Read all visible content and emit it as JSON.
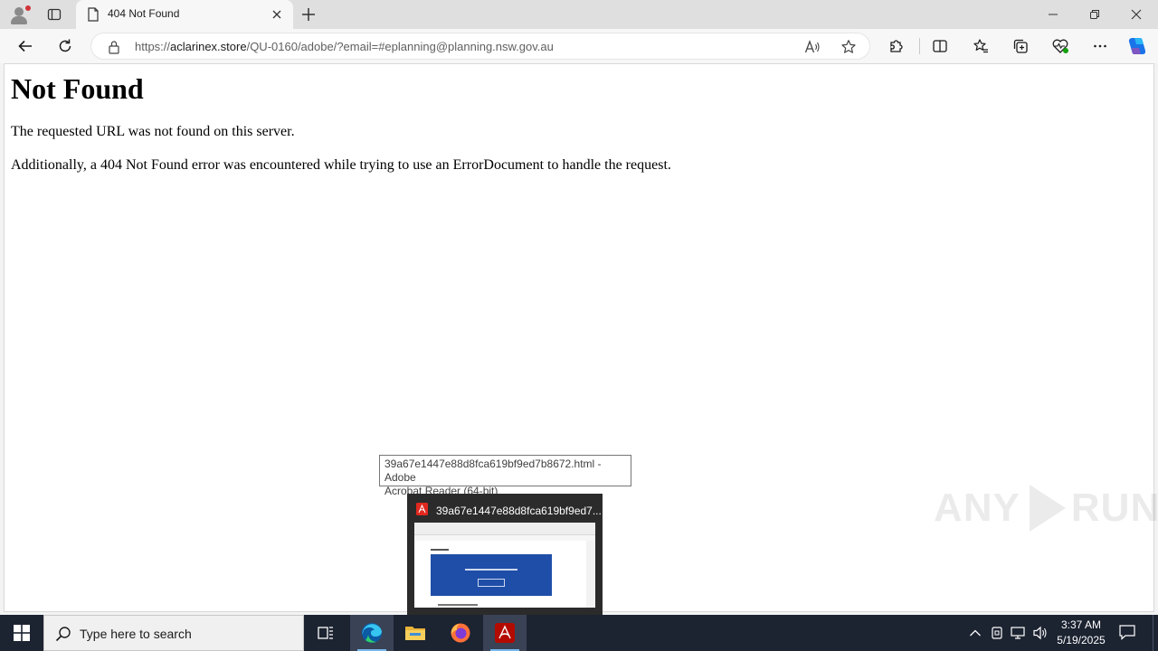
{
  "browser": {
    "tab": {
      "title": "404 Not Found"
    },
    "url": {
      "scheme": "https://",
      "host": "aclarinex.store",
      "path": "/QU-0160/adobe/?email=#eplanning@planning.nsw.gov.au"
    },
    "icons": {
      "profile": "profile-icon",
      "tab_actions": "tab-actions-icon",
      "page": "page-icon",
      "close": "close-icon",
      "new_tab": "plus-icon",
      "minimize": "minimize-icon",
      "restore": "restore-icon",
      "window_close": "close-window-icon",
      "back": "back-arrow-icon",
      "refresh": "refresh-icon",
      "lock": "lock-icon",
      "read_aloud": "read-aloud-icon",
      "favorite": "star-icon",
      "extensions": "puzzle-icon",
      "split_screen": "split-screen-icon",
      "favorites": "favorites-icon",
      "collections": "collections-icon",
      "browser_essentials": "heart-pulse-icon",
      "more": "more-icon",
      "copilot": "copilot-icon"
    }
  },
  "page": {
    "heading": "Not Found",
    "line1": "The requested URL was not found on this server.",
    "line2": "Additionally, a 404 Not Found error was encountered while trying to use an ErrorDocument to handle the request."
  },
  "watermark": {
    "text_left": "ANY",
    "text_right": "RUN"
  },
  "tooltip": {
    "line1": "39a67e1447e88d8fca619bf9ed7b8672.html - Adobe",
    "line2": "Acrobat Reader (64-bit)"
  },
  "thumbnail": {
    "title": "39a67e1447e88d8fca619bf9ed7..."
  },
  "taskbar": {
    "search_placeholder": "Type here to search",
    "clock_time": "3:37 AM",
    "clock_date": "5/19/2025",
    "apps": [
      "task-view-icon",
      "edge-icon",
      "file-explorer-icon",
      "firefox-icon",
      "acrobat-icon"
    ]
  },
  "colors": {
    "tab_strip": "#dfdfdf",
    "toolbar": "#f7f7f7",
    "taskbar": "#1c2331",
    "acrobat_red": "#b30b00",
    "accent_blue": "#1f4ea8"
  }
}
